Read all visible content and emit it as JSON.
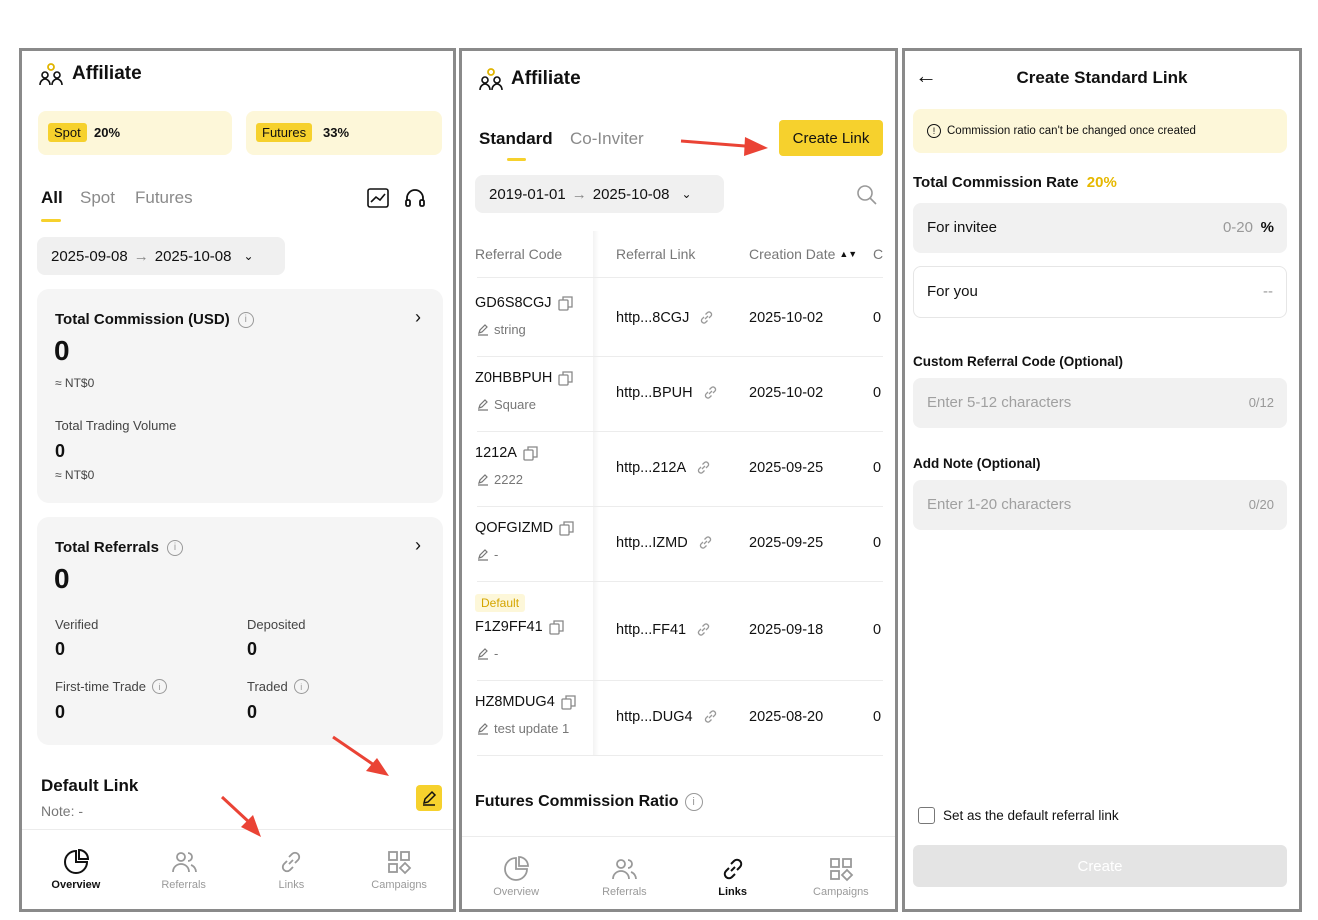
{
  "panel1": {
    "title": "Affiliate",
    "spot_tag": "Spot",
    "spot_rate": "20%",
    "futures_tag": "Futures",
    "futures_rate": "33%",
    "tabs": [
      "All",
      "Spot",
      "Futures"
    ],
    "date_start": "2025-09-08",
    "date_end": "2025-10-08",
    "total_commission_label": "Total Commission (USD)",
    "total_commission_value": "0",
    "total_commission_fiat": "≈ NT$0",
    "trading_volume_label": "Total Trading Volume",
    "trading_volume_value": "0",
    "trading_volume_fiat": "≈ NT$0",
    "total_referrals_label": "Total Referrals",
    "total_referrals_value": "0",
    "verified_label": "Verified",
    "verified_value": "0",
    "deposited_label": "Deposited",
    "deposited_value": "0",
    "first_trade_label": "First-time Trade",
    "first_trade_value": "0",
    "traded_label": "Traded",
    "traded_value": "0",
    "default_link_label": "Default Link",
    "default_link_note": "Note: -",
    "nav": [
      "Overview",
      "Referrals",
      "Links",
      "Campaigns"
    ]
  },
  "panel2": {
    "title": "Affiliate",
    "tab_standard": "Standard",
    "tab_coinviter": "Co-Inviter",
    "create_link": "Create Link",
    "date_start": "2019-01-01",
    "date_end": "2025-10-08",
    "col_code": "Referral Code",
    "col_link": "Referral Link",
    "col_date": "Creation Date",
    "col_extra": "C",
    "default_badge": "Default",
    "rows": [
      {
        "code": "GD6S8CGJ",
        "note": "string",
        "link": "http...8CGJ",
        "date": "2025-10-02",
        "extra": "0"
      },
      {
        "code": "Z0HBBPUH",
        "note": "Square",
        "link": "http...BPUH",
        "date": "2025-10-02",
        "extra": "0"
      },
      {
        "code": "1212A",
        "note": "2222",
        "link": "http...212A",
        "date": "2025-09-25",
        "extra": "0"
      },
      {
        "code": "QOFGIZMD",
        "note": "-",
        "link": "http...IZMD",
        "date": "2025-09-25",
        "extra": "0"
      },
      {
        "code": "F1Z9FF41",
        "note": "-",
        "link": "http...FF41",
        "date": "2025-09-18",
        "extra": "0"
      },
      {
        "code": "HZ8MDUG4",
        "note": "test update 1",
        "link": "http...DUG4",
        "date": "2025-08-20",
        "extra": "0"
      }
    ],
    "futures_ratio_label": "Futures Commission Ratio",
    "nav": [
      "Overview",
      "Referrals",
      "Links",
      "Campaigns"
    ]
  },
  "panel3": {
    "title": "Create Standard Link",
    "notice": "Commission ratio can't be changed once created",
    "total_rate_label": "Total Commission Rate",
    "total_rate_value": "20%",
    "invitee_label": "For invitee",
    "invitee_range": "0-20",
    "percent": "%",
    "you_label": "For you",
    "you_value": "--",
    "custom_code_label": "Custom Referral Code (Optional)",
    "custom_code_placeholder": "Enter 5-12 characters",
    "custom_code_count": "0/12",
    "note_label": "Add Note (Optional)",
    "note_placeholder": "Enter 1-20 characters",
    "note_count": "0/20",
    "default_checkbox": "Set as the default referral link",
    "create_button": "Create"
  },
  "colors": {
    "accent": "#f6d12d",
    "chip_bg": "#fdf7d9",
    "rate": "#e6b800",
    "arrow": "#ea4335"
  }
}
